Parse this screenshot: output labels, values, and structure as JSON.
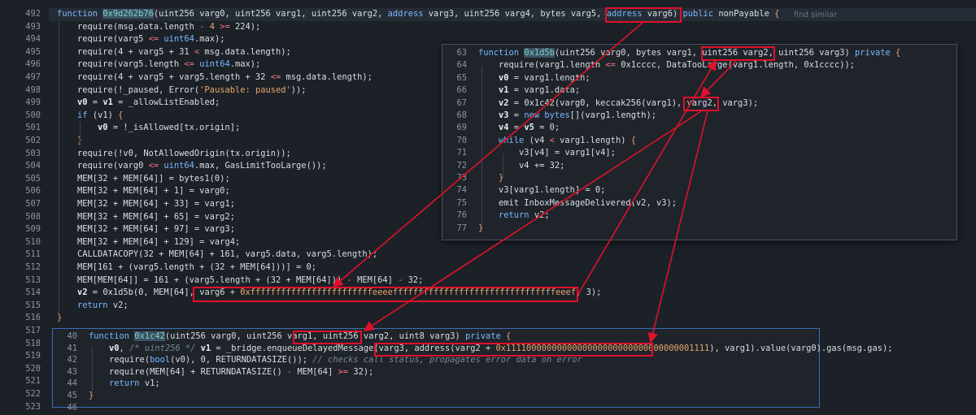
{
  "hint": "find similar",
  "main_lines": [
    {
      "n": "492",
      "segs": [
        [
          "function ",
          "kw"
        ],
        [
          "0x9d262b76",
          "sel fn"
        ],
        [
          "(uint256 ",
          ""
        ],
        [
          "varg0",
          ""
        ],
        [
          ", uint256 ",
          ""
        ],
        [
          "varg1",
          ""
        ],
        [
          ", uint256 ",
          ""
        ],
        [
          "varg2",
          ""
        ],
        [
          ", ",
          ""
        ],
        [
          "address ",
          "kw"
        ],
        [
          "varg3",
          ""
        ],
        [
          ", uint256 ",
          ""
        ],
        [
          "varg4",
          ""
        ],
        [
          ", bytes ",
          ""
        ],
        [
          "varg5",
          ""
        ],
        [
          ", ",
          ""
        ],
        [
          "address ",
          "kw"
        ],
        [
          "varg6",
          ""
        ],
        [
          ") ",
          ""
        ],
        [
          "public ",
          "kw"
        ],
        [
          "nonPayable ",
          ""
        ],
        [
          "{",
          "num"
        ]
      ]
    },
    {
      "n": "493",
      "segs": [
        [
          "    require(msg.data.length ",
          ""
        ],
        [
          "- ",
          "op"
        ],
        [
          "4 ",
          "num"
        ],
        [
          ">= ",
          "op"
        ],
        [
          "224",
          ""
        ],
        [
          ");",
          ""
        ]
      ]
    },
    {
      "n": "494",
      "segs": [
        [
          "    require(varg5 ",
          ""
        ],
        [
          "<= ",
          "op"
        ],
        [
          "uint64",
          "kw"
        ],
        [
          ".max);",
          ""
        ]
      ]
    },
    {
      "n": "495",
      "segs": [
        [
          "    require(4 + varg5 + 31 ",
          ""
        ],
        [
          "< ",
          "op"
        ],
        [
          "msg.data.length);",
          ""
        ]
      ]
    },
    {
      "n": "496",
      "segs": [
        [
          "    require(varg5.length ",
          ""
        ],
        [
          "<= ",
          "op"
        ],
        [
          "uint64",
          "kw"
        ],
        [
          ".max);",
          ""
        ]
      ]
    },
    {
      "n": "497",
      "segs": [
        [
          "    require(4 + varg5 + varg5.length + 32 ",
          ""
        ],
        [
          "<= ",
          "op"
        ],
        [
          "msg.data.length);",
          ""
        ]
      ]
    },
    {
      "n": "498",
      "segs": [
        [
          "    require(!_paused, Error(",
          ""
        ],
        [
          "'Pausable: paused'",
          "str"
        ],
        [
          "));",
          ""
        ]
      ]
    },
    {
      "n": "499",
      "segs": [
        [
          "    ",
          ""
        ],
        [
          "v0",
          "var"
        ],
        [
          " = ",
          ""
        ],
        [
          "v1",
          "var"
        ],
        [
          " = _allowListEnabled;",
          ""
        ]
      ]
    },
    {
      "n": "500",
      "segs": [
        [
          "    ",
          ""
        ],
        [
          "if ",
          "kw"
        ],
        [
          "(v1) ",
          ""
        ],
        [
          "{",
          "num"
        ]
      ]
    },
    {
      "n": "501",
      "segs": [
        [
          "        ",
          ""
        ],
        [
          "v0",
          "var"
        ],
        [
          " = !_isAllowed[tx.origin];",
          ""
        ]
      ]
    },
    {
      "n": "502",
      "segs": [
        [
          "    ",
          ""
        ],
        [
          "}",
          "num"
        ]
      ]
    },
    {
      "n": "503",
      "segs": [
        [
          "    require(!v0, NotAllowedOrigin(tx.origin));",
          ""
        ]
      ]
    },
    {
      "n": "504",
      "segs": [
        [
          "    require(varg0 ",
          ""
        ],
        [
          "<= ",
          "op"
        ],
        [
          "uint64",
          "kw"
        ],
        [
          ".max, GasLimitTooLarge());",
          ""
        ]
      ]
    },
    {
      "n": "505",
      "segs": [
        [
          "    MEM[32 + MEM[64]] = bytes1(0);",
          ""
        ]
      ]
    },
    {
      "n": "506",
      "segs": [
        [
          "    MEM[32 + MEM[64] + 1] = varg0;",
          ""
        ]
      ]
    },
    {
      "n": "507",
      "segs": [
        [
          "    MEM[32 + MEM[64] + 33] = varg1;",
          ""
        ]
      ]
    },
    {
      "n": "508",
      "segs": [
        [
          "    MEM[32 + MEM[64] + 65] = varg2;",
          ""
        ]
      ]
    },
    {
      "n": "509",
      "segs": [
        [
          "    MEM[32 + MEM[64] + 97] = varg3;",
          ""
        ]
      ]
    },
    {
      "n": "510",
      "segs": [
        [
          "    MEM[32 + MEM[64] + 129] = varg4;",
          ""
        ]
      ]
    },
    {
      "n": "511",
      "segs": [
        [
          "    CALLDATACOPY(32 + MEM[64] + 161, varg5.data, varg5.length);",
          ""
        ]
      ]
    },
    {
      "n": "512",
      "segs": [
        [
          "    MEM[161 + (varg5.length + (32 + MEM[64]))] = 0;",
          ""
        ]
      ]
    },
    {
      "n": "513",
      "segs": [
        [
          "    MEM[MEM[64]] = 161 + (varg5.length + (32 + MEM[64])) ",
          ""
        ],
        [
          "- ",
          "op"
        ],
        [
          "MEM[64] ",
          ""
        ],
        [
          "- ",
          "op"
        ],
        [
          "32;",
          ""
        ]
      ]
    },
    {
      "n": "514",
      "segs": [
        [
          "    ",
          ""
        ],
        [
          "v2",
          "var"
        ],
        [
          " = 0x1d5b(0, MEM[64], ",
          ""
        ],
        [
          "varg6 + ",
          ""
        ],
        [
          "0xffffffffffffffffffffffffeeeeffffffffffffffffffffffffffffffffeeef",
          "num"
        ],
        [
          ", 3);",
          ""
        ]
      ]
    },
    {
      "n": "515",
      "segs": [
        [
          "    ",
          ""
        ],
        [
          "return ",
          "kw"
        ],
        [
          "v2;",
          ""
        ]
      ]
    },
    {
      "n": "516",
      "segs": [
        [
          "}",
          "num"
        ]
      ]
    },
    {
      "n": "517",
      "segs": []
    },
    {
      "n": "518",
      "segs": []
    },
    {
      "n": "519",
      "segs": []
    },
    {
      "n": "520",
      "segs": []
    },
    {
      "n": "521",
      "segs": []
    },
    {
      "n": "522",
      "segs": []
    },
    {
      "n": "523",
      "segs": []
    }
  ],
  "popup_1d5b_lines": [
    {
      "n": "63",
      "segs": [
        [
          "function ",
          "kw"
        ],
        [
          "0x1d5b",
          "sel fn"
        ],
        [
          "(uint256 ",
          ""
        ],
        [
          "varg0",
          ""
        ],
        [
          ", bytes ",
          ""
        ],
        [
          "varg1",
          ""
        ],
        [
          ", ",
          ""
        ],
        [
          "uint256 ",
          ""
        ],
        [
          "varg2",
          ""
        ],
        [
          ", uint256 ",
          ""
        ],
        [
          "varg3",
          ""
        ],
        [
          ") ",
          ""
        ],
        [
          "private ",
          "kw"
        ],
        [
          "{",
          "num"
        ]
      ]
    },
    {
      "n": "64",
      "segs": [
        [
          "    require(varg1.length ",
          ""
        ],
        [
          "<= ",
          "op"
        ],
        [
          "0x1cccc",
          ""
        ],
        [
          ", DataTooLarge(varg1.length, 0x1cccc));",
          ""
        ]
      ]
    },
    {
      "n": "65",
      "segs": [
        [
          "    ",
          ""
        ],
        [
          "v0",
          "var"
        ],
        [
          " = varg1.length;",
          ""
        ]
      ]
    },
    {
      "n": "66",
      "segs": [
        [
          "    ",
          ""
        ],
        [
          "v1",
          "var"
        ],
        [
          " = varg1.data;",
          ""
        ]
      ]
    },
    {
      "n": "67",
      "segs": [
        [
          "    ",
          ""
        ],
        [
          "v2",
          "var"
        ],
        [
          " = 0x1c42(varg0, keccak256(varg1), ",
          ""
        ],
        [
          "varg2",
          ""
        ],
        [
          ", varg3);",
          ""
        ]
      ]
    },
    {
      "n": "68",
      "segs": [
        [
          "    ",
          ""
        ],
        [
          "v3",
          "var"
        ],
        [
          " = ",
          ""
        ],
        [
          "new ",
          "kw"
        ],
        [
          "bytes",
          "kw"
        ],
        [
          "[](varg1.length);",
          ""
        ]
      ]
    },
    {
      "n": "69",
      "segs": [
        [
          "    ",
          ""
        ],
        [
          "v4",
          "var"
        ],
        [
          " = ",
          ""
        ],
        [
          "v5",
          "var"
        ],
        [
          " = 0;",
          ""
        ]
      ]
    },
    {
      "n": "70",
      "segs": [
        [
          "    ",
          ""
        ],
        [
          "while ",
          "kw"
        ],
        [
          "(v4 ",
          ""
        ],
        [
          "< ",
          "op"
        ],
        [
          "varg1.length) ",
          ""
        ],
        [
          "{",
          "num"
        ]
      ]
    },
    {
      "n": "71",
      "segs": [
        [
          "        v3[v4] = varg1[v4];",
          ""
        ]
      ]
    },
    {
      "n": "72",
      "segs": [
        [
          "        v4 += 32;",
          ""
        ]
      ]
    },
    {
      "n": "73",
      "segs": [
        [
          "    ",
          ""
        ],
        [
          "}",
          "num"
        ]
      ]
    },
    {
      "n": "74",
      "segs": [
        [
          "    v3[varg1.length] = 0;",
          ""
        ]
      ]
    },
    {
      "n": "75",
      "segs": [
        [
          "    emit InboxMessageDelivered(v2, v3);",
          ""
        ]
      ]
    },
    {
      "n": "76",
      "segs": [
        [
          "    ",
          ""
        ],
        [
          "return ",
          "kw"
        ],
        [
          "v2;",
          ""
        ]
      ]
    },
    {
      "n": "77",
      "segs": [
        [
          "}",
          "num"
        ]
      ]
    }
  ],
  "popup_1c42_lines": [
    {
      "n": "40",
      "segs": [
        [
          "function ",
          "kw"
        ],
        [
          "0x1c42",
          "sel fn"
        ],
        [
          "(uint256 ",
          ""
        ],
        [
          "varg0",
          ""
        ],
        [
          ", uint256 ",
          ""
        ],
        [
          "varg1",
          ""
        ],
        [
          ", ",
          ""
        ],
        [
          "uint256 ",
          ""
        ],
        [
          "varg2",
          ""
        ],
        [
          ", uint8 ",
          ""
        ],
        [
          "varg3",
          ""
        ],
        [
          ") ",
          ""
        ],
        [
          "private ",
          "kw"
        ],
        [
          "{",
          "num"
        ]
      ]
    },
    {
      "n": "41",
      "segs": [
        [
          "    ",
          ""
        ],
        [
          "v0",
          "var"
        ],
        [
          ", ",
          ""
        ],
        [
          "/* uint256 */ ",
          "cm"
        ],
        [
          "v1",
          "var"
        ],
        [
          " = _bridge.enqueueDelayedMessage(varg3, ",
          ""
        ],
        [
          "address(varg2 + ",
          ""
        ],
        [
          "0x1111000000000000000000000000000000001111",
          "num"
        ],
        [
          ")",
          ""
        ],
        [
          ", varg1).value(varg0).gas(msg.gas);",
          ""
        ]
      ]
    },
    {
      "n": "42",
      "segs": [
        [
          "    require(",
          ""
        ],
        [
          "bool",
          "kw"
        ],
        [
          "(v0), 0, RETURNDATASIZE()); ",
          ""
        ],
        [
          "// checks call status, propagates error data on error",
          "cm"
        ]
      ]
    },
    {
      "n": "43",
      "segs": [
        [
          "    require(MEM[64] + RETURNDATASIZE() ",
          ""
        ],
        [
          "- ",
          "op"
        ],
        [
          "MEM[64] ",
          ""
        ],
        [
          ">= ",
          "op"
        ],
        [
          "32);",
          ""
        ]
      ]
    },
    {
      "n": "44",
      "segs": [
        [
          "    ",
          ""
        ],
        [
          "return ",
          "kw"
        ],
        [
          "v1;",
          ""
        ]
      ]
    },
    {
      "n": "45",
      "segs": [
        [
          "}",
          "num"
        ]
      ]
    },
    {
      "n": "46",
      "segs": []
    }
  ],
  "accent_color": "#e0112a"
}
